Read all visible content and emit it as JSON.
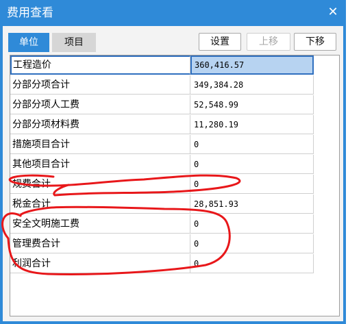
{
  "title": "费用查看",
  "tabs": [
    {
      "label": "单位",
      "active": true
    },
    {
      "label": "项目",
      "active": false
    }
  ],
  "buttons": {
    "settings": "设置",
    "move_up": "上移",
    "move_down": "下移"
  },
  "rows": [
    {
      "name": "工程造价",
      "value": "360,416.57"
    },
    {
      "name": "分部分项合计",
      "value": "349,384.28"
    },
    {
      "name": "分部分项人工费",
      "value": "52,548.99"
    },
    {
      "name": "分部分项材料费",
      "value": "11,280.19"
    },
    {
      "name": "措施项目合计",
      "value": "0"
    },
    {
      "name": "其他项目合计",
      "value": "0"
    },
    {
      "name": "规费合计",
      "value": "0"
    },
    {
      "name": "税金合计",
      "value": "28,851.93"
    },
    {
      "name": "安全文明施工费",
      "value": "0"
    },
    {
      "name": "管理费合计",
      "value": "0"
    },
    {
      "name": "利润合计",
      "value": "0"
    }
  ],
  "colors": {
    "accent": "#2f8ad8",
    "annotation": "#e8171a",
    "selection": "#b7d3f1"
  }
}
